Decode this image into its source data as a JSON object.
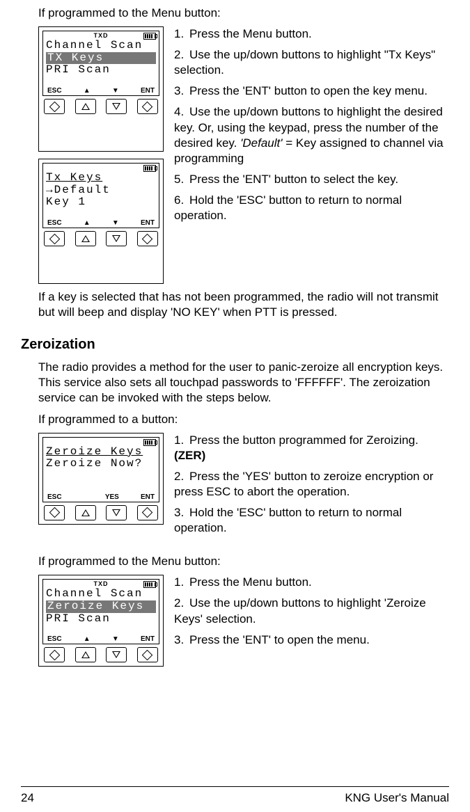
{
  "intro1": "If programmed to the Menu button:",
  "screen1": {
    "txd": "TXD",
    "line1": "Channel Scan",
    "line2": "TX Keys",
    "line3": "PRI Scan",
    "soft": {
      "esc": "ESC",
      "up": "▲",
      "down": "▼",
      "ent": "ENT"
    }
  },
  "screen2": {
    "line1": "Tx Keys",
    "line2": "→Default",
    "line3": "  Key 1",
    "soft": {
      "esc": "ESC",
      "up": "▲",
      "down": "▼",
      "ent": "ENT"
    }
  },
  "steps_a": [
    "Press the Menu button.",
    "Use the up/down buttons to highlight \"Tx Keys\" selection.",
    "Press the 'ENT' button to open the key menu.",
    "Use the up/down buttons to highlight the desired key. Or, using the keypad, press the number of the desired key. ",
    "Press the 'ENT' button to select the key.",
    "Hold the 'ESC' button to return to normal operation."
  ],
  "step_a4_italic": "'Default'",
  "step_a4_tail": " = Key assigned to channel via programming",
  "note_a": "If a key is selected that has not been programmed, the radio will not transmit but will beep and display 'NO KEY' when PTT is pressed.",
  "section": "Zeroization",
  "zero_intro": "The radio provides a method for the user to panic-zeroize all encryption keys.  This service also sets all touchpad passwords to 'FFFFFF'.  The zeroization service can be invoked with the steps below.",
  "intro2": "If programmed to a button:",
  "screen3": {
    "line1": "Zeroize Keys",
    "line2": "Zeroize Now?",
    "soft": {
      "esc": "ESC",
      "yes": "YES",
      "ent": "ENT"
    }
  },
  "steps_b": [
    "Press the button programmed for Zeroizing. ",
    "Press the 'YES' button to zeroize encryption or press ESC to abort the operation.",
    "Hold the 'ESC' button to return to normal operation."
  ],
  "step_b1_bold": "(ZER)",
  "intro3": "If programmed to the Menu button:",
  "screen4": {
    "txd": "TXD",
    "line1": "Channel Scan",
    "line2": "Zeroize Keys",
    "line3": "PRI Scan",
    "soft": {
      "esc": "ESC",
      "up": "▲",
      "down": "▼",
      "ent": "ENT"
    }
  },
  "steps_c": [
    "Press the Menu button.",
    "Use the up/down buttons to highlight 'Zeroize Keys' selection.",
    "Press the 'ENT' to open the menu."
  ],
  "footer": {
    "page": "24",
    "title": "KNG User's Manual"
  }
}
